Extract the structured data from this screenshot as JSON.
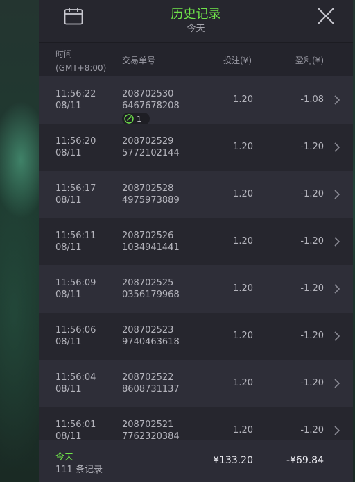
{
  "header": {
    "title": "历史记录",
    "subtitle": "今天",
    "calendar_icon": "calendar-icon",
    "close_icon": "close-icon"
  },
  "columns": {
    "time_line1": "时间",
    "time_line2": "(GMT+8:00)",
    "order": "交易单号",
    "bet": "投注(¥)",
    "profit": "盈利(¥)"
  },
  "rows": [
    {
      "time": "11:56:22",
      "date": "08/11",
      "order_line1": "208702530",
      "order_line2": "6467678208",
      "badge": "1",
      "bet": "1.20",
      "profit": "-1.08"
    },
    {
      "time": "11:56:20",
      "date": "08/11",
      "order_line1": "208702529",
      "order_line2": "5772102144",
      "bet": "1.20",
      "profit": "-1.20"
    },
    {
      "time": "11:56:17",
      "date": "08/11",
      "order_line1": "208702528",
      "order_line2": "4975973889",
      "bet": "1.20",
      "profit": "-1.20"
    },
    {
      "time": "11:56:11",
      "date": "08/11",
      "order_line1": "208702526",
      "order_line2": "1034941441",
      "bet": "1.20",
      "profit": "-1.20"
    },
    {
      "time": "11:56:09",
      "date": "08/11",
      "order_line1": "208702525",
      "order_line2": "0356179968",
      "bet": "1.20",
      "profit": "-1.20"
    },
    {
      "time": "11:56:06",
      "date": "08/11",
      "order_line1": "208702523",
      "order_line2": "9740463618",
      "bet": "1.20",
      "profit": "-1.20"
    },
    {
      "time": "11:56:04",
      "date": "08/11",
      "order_line1": "208702522",
      "order_line2": "8608731137",
      "bet": "1.20",
      "profit": "-1.20"
    },
    {
      "time": "11:56:01",
      "date": "08/11",
      "order_line1": "208702521",
      "order_line2": "7762320384",
      "bet": "1.20",
      "profit": "-1.20"
    }
  ],
  "footer": {
    "period": "今天",
    "count": "111 条记录",
    "total_bet": "¥133.20",
    "total_profit": "-¥69.84"
  },
  "colors": {
    "accent": "#6fe34a",
    "panel_bg": "#24242c"
  }
}
